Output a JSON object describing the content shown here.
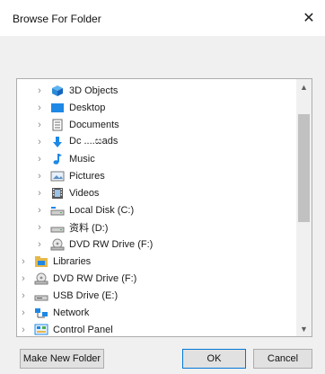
{
  "window": {
    "title": "Browse For Folder",
    "close_glyph": "✕"
  },
  "tree": {
    "items": [
      {
        "label": "3D Objects",
        "icon": "3d-objects-icon",
        "level": 1
      },
      {
        "label": "Desktop",
        "icon": "desktop-icon",
        "level": 1
      },
      {
        "label": "Documents",
        "icon": "documents-icon",
        "level": 1
      },
      {
        "label": "Dc ....සads",
        "icon": "downloads-icon",
        "level": 1
      },
      {
        "label": "Music",
        "icon": "music-icon",
        "level": 1
      },
      {
        "label": "Pictures",
        "icon": "pictures-icon",
        "level": 1
      },
      {
        "label": "Videos",
        "icon": "videos-icon",
        "level": 1
      },
      {
        "label": "Local Disk (C:)",
        "icon": "local-disk-icon",
        "level": 1
      },
      {
        "label": "资料 (D:)",
        "icon": "drive-icon",
        "level": 1
      },
      {
        "label": "DVD RW Drive (F:)",
        "icon": "dvd-drive-icon",
        "level": 1
      },
      {
        "label": "Libraries",
        "icon": "libraries-icon",
        "level": 0
      },
      {
        "label": "DVD RW Drive (F:)",
        "icon": "dvd-drive-icon",
        "level": 0
      },
      {
        "label": "USB Drive (E:)",
        "icon": "usb-drive-icon",
        "level": 0
      },
      {
        "label": "Network",
        "icon": "network-icon",
        "level": 0
      },
      {
        "label": "Control Panel",
        "icon": "control-panel-icon",
        "level": 0
      }
    ],
    "chevron_glyph": "›"
  },
  "buttons": {
    "make_new_folder": "Make New Folder",
    "ok": "OK",
    "cancel": "Cancel"
  },
  "colors": {
    "selection_border": "#0078d7",
    "folder_blue": "#1e88e5",
    "folder_yellow": "#e6b84a"
  }
}
